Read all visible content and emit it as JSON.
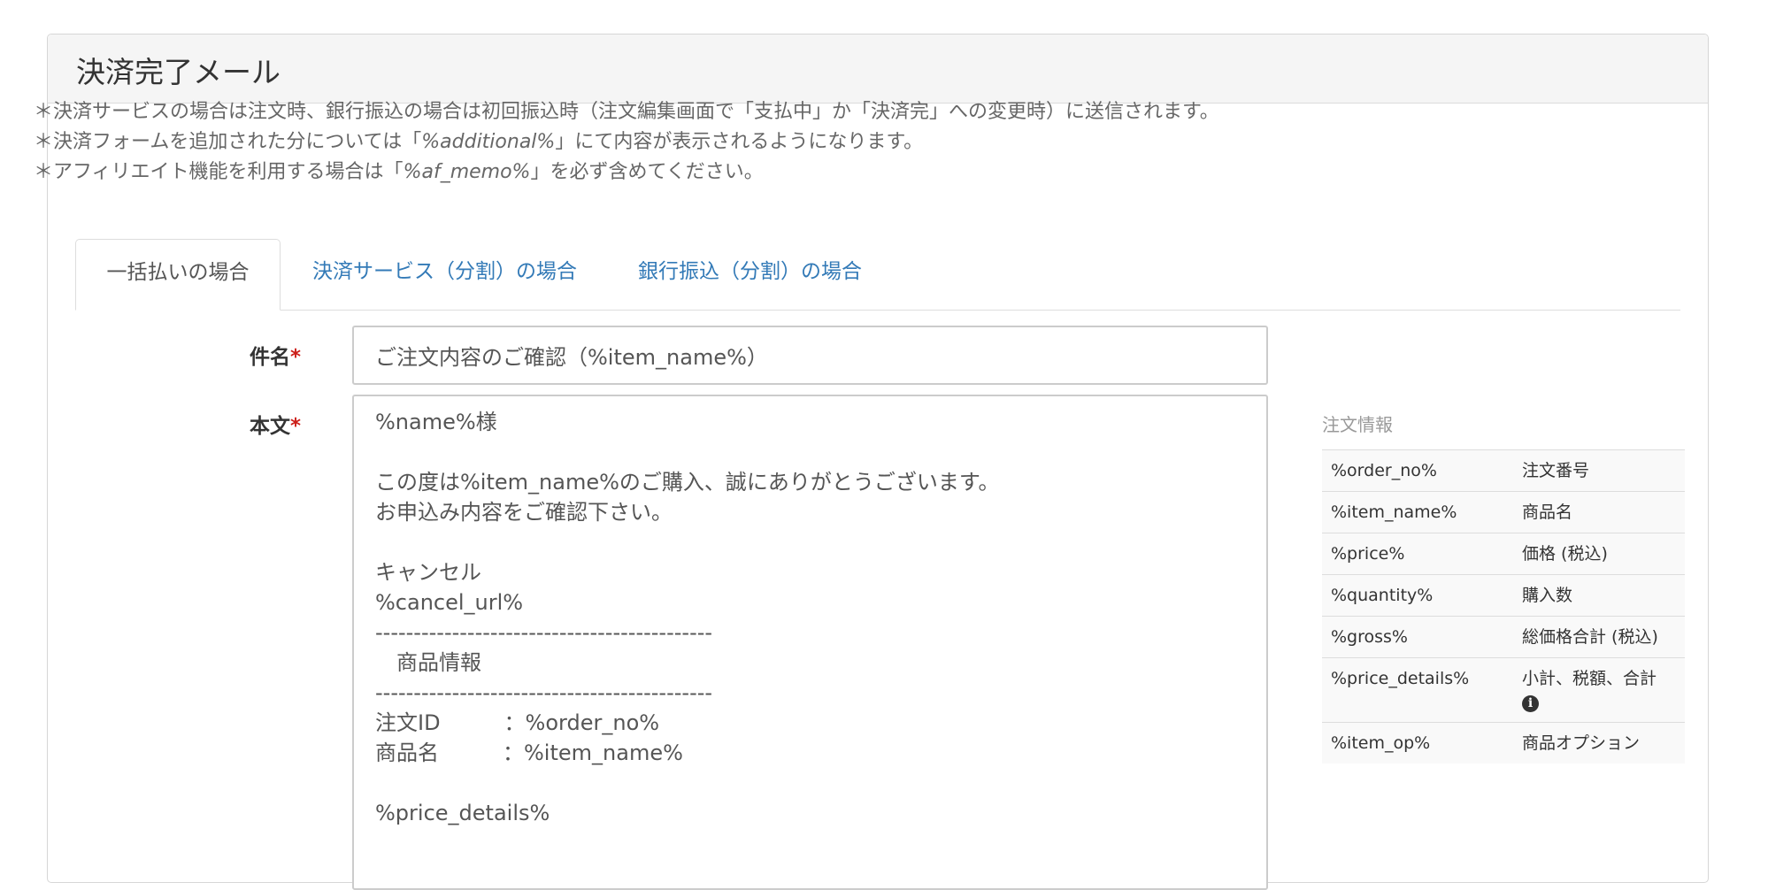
{
  "panel": {
    "title": "決済完了メール"
  },
  "notes": {
    "line1": "＊決済サービスの場合は注文時、銀行振込の場合は初回振込時（注文編集画面で「支払中」か「決済完」への変更時）に送信されます。",
    "line2_pre": "＊決済フォームを追加された分については「",
    "line2_var": "%additional%",
    "line2_post": "」にて内容が表示されるようになります。",
    "line3_pre": "＊アフィリエイト機能を利用する場合は「",
    "line3_var": "%af_memo%",
    "line3_post": "」を必ず含めてください。"
  },
  "tabs": [
    {
      "label": "一括払いの場合"
    },
    {
      "label": "決済サービス（分割）の場合"
    },
    {
      "label": "銀行振込（分割）の場合"
    }
  ],
  "form": {
    "subject_label": "件名",
    "body_label": "本文",
    "required_mark": "*",
    "subject_value": "ご注文内容のご確認（%item_name%）",
    "body_value": "%name%様\n\nこの度は%item_name%のご購入、誠にありがとうございます。\nお申込み内容をご確認下さい。\n\nキャンセル\n%cancel_url%\n--------------------------------------------\n　商品情報\n--------------------------------------------\n注文ID　　　：%order_no%\n商品名　　　：%item_name%\n\n%price_details%"
  },
  "sidebar": {
    "title": "注文情報",
    "rows": [
      {
        "key": "%order_no%",
        "desc": "注文番号"
      },
      {
        "key": "%item_name%",
        "desc": "商品名"
      },
      {
        "key": "%price%",
        "desc": "価格 (税込)"
      },
      {
        "key": "%quantity%",
        "desc": "購入数"
      },
      {
        "key": "%gross%",
        "desc": "総価格合計 (税込)"
      },
      {
        "key": "%price_details%",
        "desc": "小計、税額、合計"
      },
      {
        "key": "%item_op%",
        "desc": "商品オプション"
      }
    ],
    "info_icon": "info-circle-icon"
  }
}
